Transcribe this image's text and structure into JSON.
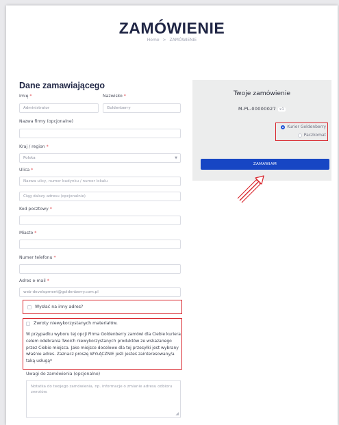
{
  "header": {
    "title": "ZAMÓWIENIE",
    "breadcrumb": {
      "home": "Home",
      "separator": ">",
      "current": "ZAMÓWIENIE"
    }
  },
  "billing": {
    "section_title": "Dane zamawiającego",
    "first_name": {
      "label": "Imię",
      "value": "Administrator"
    },
    "last_name": {
      "label": "Nazwisko",
      "value": "Goldenberry"
    },
    "company": {
      "label": "Nazwa firmy (opcjonalne)",
      "value": ""
    },
    "country": {
      "label": "Kraj / region",
      "value": "Polska"
    },
    "street": {
      "label": "Ulica",
      "placeholder_1": "Nazwa ulicy, numer budynku / numer lokalu",
      "placeholder_2": "Ciąg dalszy adresu (opcjonalnie)"
    },
    "postcode": {
      "label": "Kod pocztowy",
      "value": ""
    },
    "city": {
      "label": "Miasto",
      "value": ""
    },
    "phone": {
      "label": "Numer telefonu",
      "value": ""
    },
    "email": {
      "label": "Adres e-mail",
      "value": "web-development@goldenberry.com.pl"
    },
    "required_mark": "*"
  },
  "ship_elsewhere": {
    "label": "Wysłać na inny adres?"
  },
  "returns": {
    "label": "Zwroty niewykorzystanych materiałów.",
    "info": "W przypadku wyboru tej opcji Firma Goldenberry zamówi dla Ciebie kuriera celem odebrania Twoich niewykorzystanych produktów ze wskazanego przez Ciebie miejsca. Jako miejsce docelowe dla tej przesyłki jest wybrany właśnie adres. Zaznacz proszę WYŁĄCZNIE jeśli jesteś zainteresowany/a taką usługą*"
  },
  "notes": {
    "label": "Uwagi do zamówienia (opcjonalne)",
    "placeholder": "Notatka do twojego zamówienia, np. informacje o zmianie adresu odbioru zwrotów."
  },
  "summary": {
    "title": "Twoje zamówienie",
    "order_number": "M-PL-00000027",
    "quantity": "x1",
    "shipping_options": [
      {
        "label": "Kurier Goldenberry",
        "selected": true
      },
      {
        "label": "Paczkomat",
        "selected": false
      }
    ],
    "submit_label": "ZAMAWIAM"
  },
  "colors": {
    "accent": "#1746c4",
    "highlight": "#d8232a",
    "title": "#1f2544"
  }
}
